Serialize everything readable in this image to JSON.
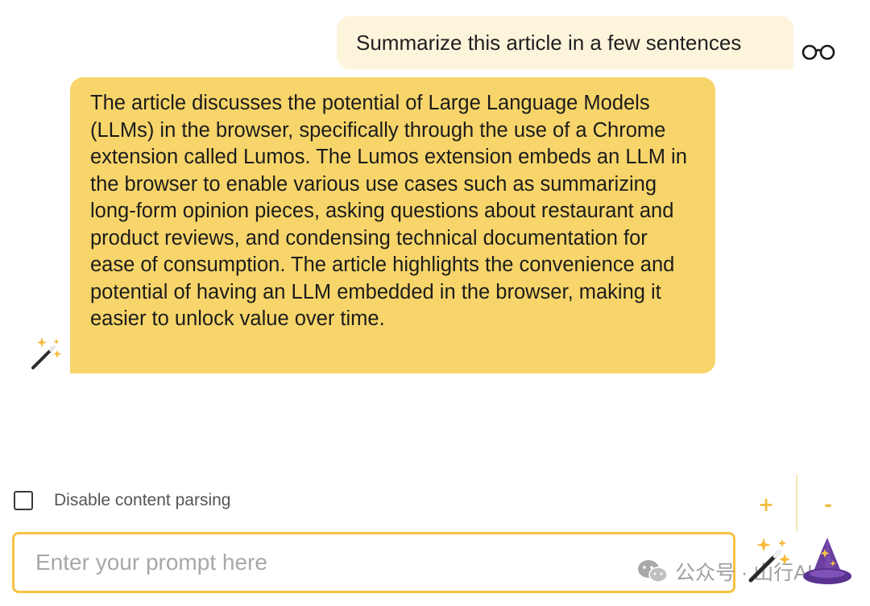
{
  "conversation": {
    "user_message": "Summarize this article in a few sentences",
    "assistant_message": "The article discusses the potential of Large Language Models (LLMs) in the browser, specifically through the use of a Chrome extension called Lumos. The Lumos extension embeds an LLM in the browser to enable various use cases such as summarizing long-form opinion pieces, asking questions about restaurant and product reviews, and condensing technical documentation for ease of consumption. The article highlights the convenience and potential of having an LLM embedded in the browser, making it easier to unlock value over time."
  },
  "controls": {
    "disable_parsing_label": "Disable content parsing",
    "disable_parsing_checked": false,
    "zoom_in_label": "+",
    "zoom_out_label": "-"
  },
  "prompt": {
    "placeholder": "Enter your prompt here",
    "value": ""
  },
  "watermark": {
    "text": "公众号 · 山行AI"
  },
  "icons": {
    "user_avatar": "glasses-icon",
    "assistant_avatar": "magic-wand-icon",
    "send": "magic-wand-icon",
    "app_logo": "wizard-hat-icon",
    "watermark": "wechat-icon"
  },
  "colors": {
    "user_bubble": "#fdf4dc",
    "assistant_bubble": "#f7d56a",
    "accent": "#f5c342",
    "zoom_buttons": "#f2bd3c"
  }
}
